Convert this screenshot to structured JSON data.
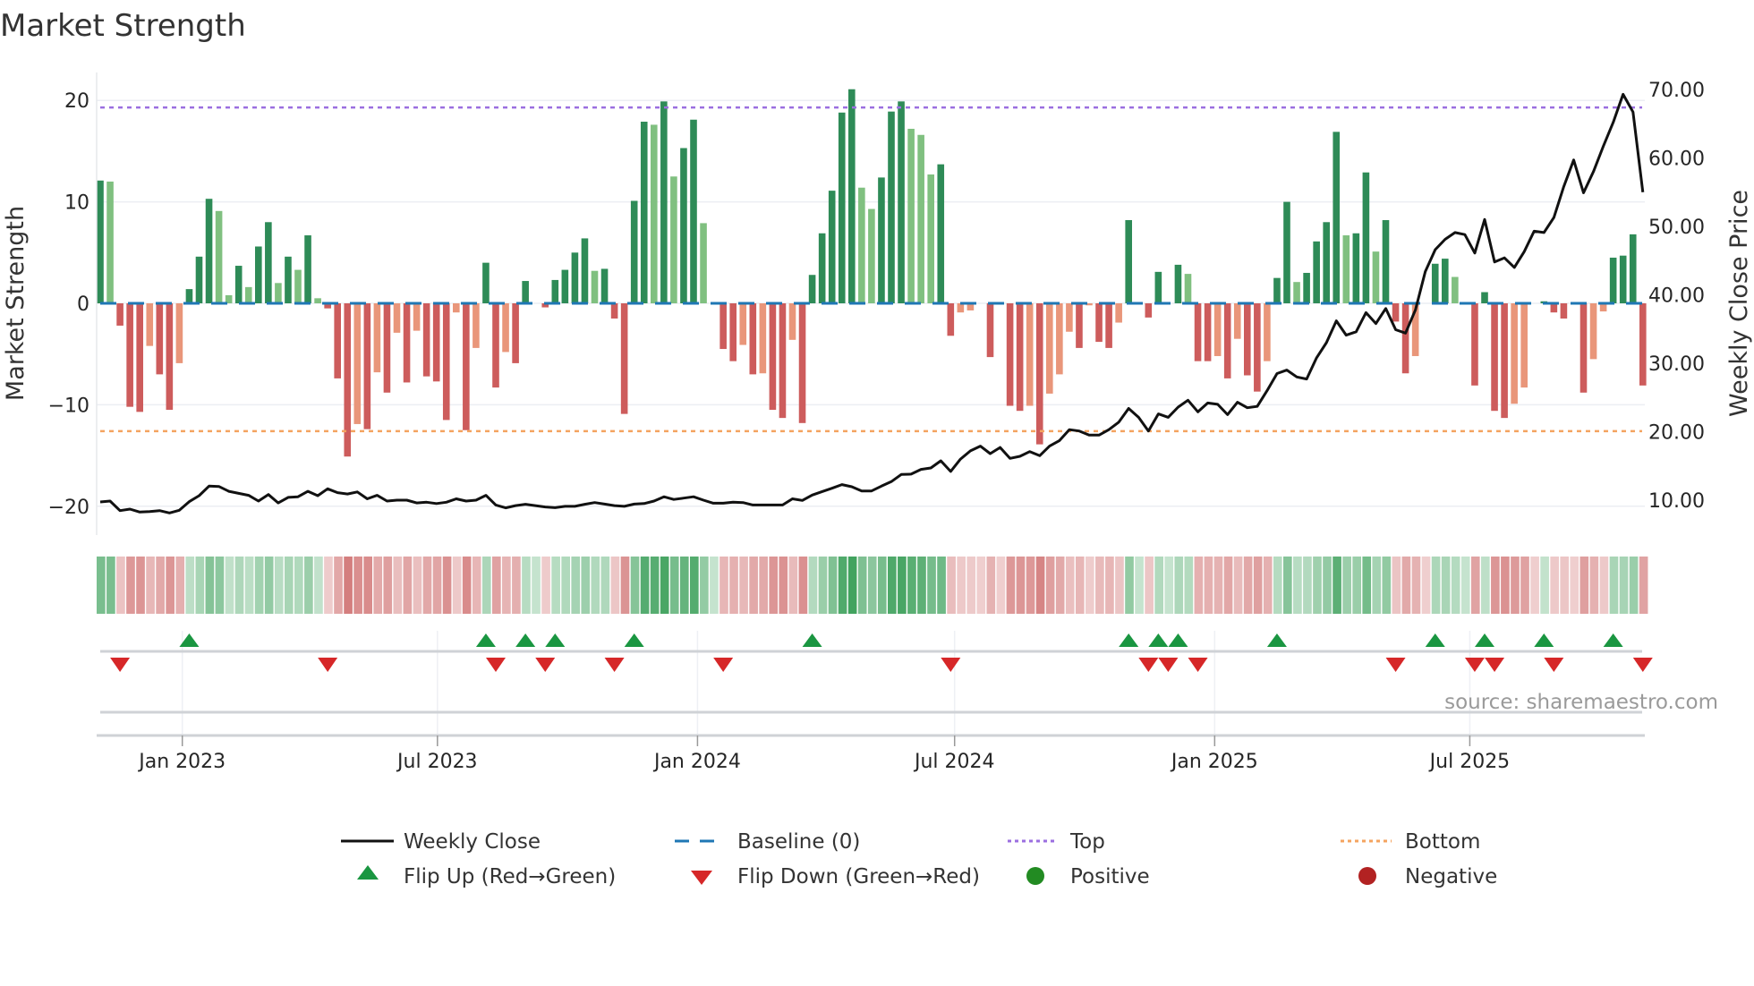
{
  "title": "Market Strength",
  "source": "source: sharemaestro.com",
  "legend": {
    "weekly_close": "Weekly Close",
    "baseline": "Baseline (0)",
    "top": "Top",
    "bottom": "Bottom",
    "flip_up": "Flip Up (Red→Green)",
    "flip_down": "Flip Down (Green→Red)",
    "positive": "Positive",
    "negative": "Negative"
  },
  "colors": {
    "strong_up": "#2e8b57",
    "weak_up": "#80c080",
    "strong_down": "#cd5c5c",
    "weak_down": "#e9967a",
    "top": "#9b6fe0",
    "bottom": "#f4a460",
    "baseline": "#1f77b4",
    "price": "#111111",
    "flip_up": "#1a9641",
    "flip_down": "#d62728",
    "positive": "#228b22",
    "negative": "#b22222"
  },
  "chart_data": {
    "type": "bar",
    "title": "Market Strength",
    "ylabel": "Market Strength",
    "y2label": "Weekly Close Price",
    "ylim": [
      -22.5,
      23
    ],
    "y2lim": [
      7,
      73
    ],
    "yticks": [
      "20",
      "10",
      "0",
      "−10",
      "−20"
    ],
    "ytick_values": [
      20,
      10,
      0,
      -10,
      -20
    ],
    "y2ticks": [
      "70.00",
      "60.00",
      "50.00",
      "40.00",
      "30.00",
      "20.00",
      "10.00"
    ],
    "y2tick_values": [
      70,
      60,
      50,
      40,
      30,
      20,
      10
    ],
    "top_level": 19.3,
    "bottom_level": -12.6,
    "baseline": 0,
    "x_ticks": [
      {
        "label": "Jan 2023",
        "week": 9.3
      },
      {
        "label": "Jul 2023",
        "week": 35.1
      },
      {
        "label": "Jan 2024",
        "week": 61.4
      },
      {
        "label": "Jul 2024",
        "week": 87.4
      },
      {
        "label": "Jan 2025",
        "week": 113.7
      },
      {
        "label": "Jul 2025",
        "week": 139.5
      }
    ],
    "strength": [
      12.1,
      12.0,
      -2.2,
      -10.2,
      -10.7,
      -4.2,
      -7.0,
      -10.5,
      -5.9,
      1.4,
      4.6,
      10.3,
      9.1,
      0.8,
      3.7,
      1.6,
      5.6,
      8.0,
      2.0,
      4.6,
      3.3,
      6.7,
      0.5,
      -0.5,
      -7.4,
      -15.1,
      -11.9,
      -12.4,
      -6.8,
      -8.8,
      -2.9,
      -7.8,
      -2.7,
      -7.2,
      -7.7,
      -11.5,
      -0.9,
      -12.5,
      -4.4,
      4.0,
      -8.3,
      -4.8,
      -5.9,
      2.2,
      0,
      -0.4,
      2.3,
      3.3,
      5.0,
      6.4,
      3.2,
      3.4,
      -1.5,
      -10.9,
      10.1,
      17.9,
      17.6,
      19.9,
      12.5,
      15.3,
      18.1,
      7.9,
      0,
      -4.5,
      -5.7,
      -4.1,
      -7.0,
      -6.9,
      -10.5,
      -11.3,
      -3.6,
      -11.8,
      2.8,
      6.9,
      11.1,
      18.8,
      21.1,
      11.4,
      9.3,
      12.4,
      18.9,
      19.9,
      17.2,
      16.6,
      12.7,
      13.7,
      -3.2,
      -0.9,
      -0.7,
      0,
      -5.3,
      0,
      -10.1,
      -10.6,
      -10.1,
      -13.9,
      -8.9,
      -7.0,
      -2.8,
      -4.4,
      -0.2,
      -3.8,
      -4.4,
      -1.9,
      8.2,
      0,
      -1.4,
      3.1,
      0,
      3.8,
      2.9,
      -5.7,
      -5.7,
      -5.2,
      -7.4,
      -3.5,
      -7.1,
      -8.7,
      -5.7,
      2.5,
      10.0,
      2.1,
      3.0,
      6.1,
      8.0,
      16.9,
      6.7,
      6.9,
      12.9,
      5.1,
      8.2,
      -1.8,
      -6.9,
      -5.2,
      0,
      3.9,
      4.4,
      2.6,
      0,
      -8.1,
      1.1,
      -10.6,
      -11.3,
      -9.9,
      -8.3,
      0,
      0.2,
      -0.9,
      -1.5,
      0,
      -8.8,
      -5.5,
      -0.8,
      4.5,
      4.7,
      6.8,
      -8.1
    ],
    "bar_style": [
      "G",
      "g",
      "R",
      "R",
      "R",
      "r",
      "R",
      "R",
      "r",
      "G",
      "G",
      "G",
      "g",
      "g",
      "G",
      "g",
      "G",
      "G",
      "g",
      "G",
      "g",
      "G",
      "g",
      "R",
      "R",
      "R",
      "r",
      "R",
      "r",
      "R",
      "r",
      "R",
      "r",
      "R",
      "R",
      "R",
      "r",
      "R",
      "r",
      "G",
      "R",
      "r",
      "R",
      "G",
      "0",
      "R",
      "G",
      "G",
      "G",
      "G",
      "g",
      "G",
      "R",
      "R",
      "G",
      "G",
      "g",
      "G",
      "g",
      "G",
      "G",
      "g",
      "0",
      "R",
      "R",
      "r",
      "R",
      "r",
      "R",
      "R",
      "r",
      "R",
      "G",
      "G",
      "G",
      "G",
      "G",
      "g",
      "g",
      "G",
      "G",
      "G",
      "g",
      "g",
      "g",
      "G",
      "R",
      "r",
      "r",
      "0",
      "R",
      "0",
      "R",
      "R",
      "r",
      "R",
      "r",
      "r",
      "r",
      "R",
      "r",
      "R",
      "R",
      "r",
      "G",
      "0",
      "R",
      "G",
      "0",
      "G",
      "g",
      "R",
      "R",
      "r",
      "R",
      "r",
      "R",
      "R",
      "r",
      "G",
      "G",
      "g",
      "G",
      "G",
      "G",
      "G",
      "g",
      "G",
      "G",
      "g",
      "G",
      "R",
      "R",
      "r",
      "0",
      "G",
      "G",
      "g",
      "0",
      "R",
      "G",
      "R",
      "R",
      "r",
      "r",
      "0",
      "G",
      "R",
      "R",
      "0",
      "R",
      "r",
      "r",
      "G",
      "G",
      "G",
      "R"
    ],
    "weekly_close": [
      9.74,
      9.87,
      8.47,
      8.69,
      8.26,
      8.34,
      8.47,
      8.13,
      8.52,
      9.78,
      10.65,
      12.05,
      12.0,
      11.3,
      11.0,
      10.7,
      9.87,
      10.83,
      9.6,
      10.4,
      10.5,
      11.3,
      10.65,
      11.66,
      11.1,
      10.9,
      11.2,
      10.2,
      10.7,
      9.87,
      10.0,
      10.0,
      9.6,
      9.7,
      9.5,
      9.7,
      10.2,
      9.87,
      10.0,
      10.7,
      9.3,
      8.87,
      9.2,
      9.4,
      9.2,
      9.0,
      8.9,
      9.1,
      9.1,
      9.4,
      9.65,
      9.43,
      9.2,
      9.1,
      9.43,
      9.5,
      9.87,
      10.5,
      10.1,
      10.3,
      10.5,
      10.0,
      9.56,
      9.56,
      9.7,
      9.65,
      9.3,
      9.3,
      9.3,
      9.3,
      10.2,
      9.96,
      10.74,
      11.26,
      11.74,
      12.27,
      11.96,
      11.35,
      11.35,
      12.05,
      12.7,
      13.75,
      13.8,
      14.5,
      14.7,
      15.75,
      14.2,
      16.0,
      17.2,
      17.9,
      16.8,
      17.7,
      16.1,
      16.4,
      17.1,
      16.5,
      17.9,
      18.7,
      20.3,
      20.1,
      19.5,
      19.5,
      20.3,
      21.4,
      23.4,
      22.1,
      20.1,
      22.6,
      22.1,
      23.6,
      24.6,
      22.9,
      24.2,
      24.0,
      22.5,
      24.3,
      23.5,
      23.7,
      26.0,
      28.5,
      29.0,
      28.0,
      27.7,
      30.8,
      33.0,
      36.2,
      34.1,
      34.6,
      37.4,
      35.8,
      38.0,
      34.9,
      34.4,
      37.8,
      43.4,
      46.6,
      48.1,
      49.1,
      48.8,
      46.1,
      51.0,
      44.8,
      45.4,
      44.0,
      46.3,
      49.3,
      49.1,
      51.3,
      55.8,
      59.7,
      54.9,
      58.0,
      61.7,
      65.2,
      69.3,
      66.7,
      55.0
    ],
    "flip_up_weeks": [
      10,
      40,
      44,
      47,
      55,
      73,
      105,
      108,
      110,
      120,
      136,
      141,
      147,
      154
    ],
    "flip_down_weeks": [
      3,
      24,
      41,
      46,
      53,
      64,
      87,
      107,
      109,
      112,
      132,
      140,
      142,
      148,
      157
    ]
  }
}
